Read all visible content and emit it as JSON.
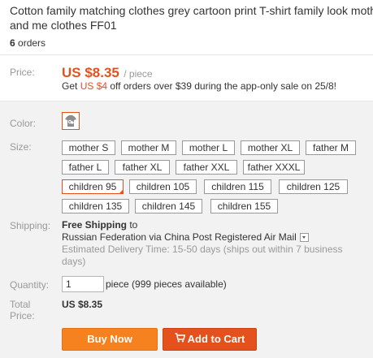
{
  "product": {
    "title_line1": "Cotton family matching clothes grey cartoon print T-shirt family look moth",
    "title_line2": "and me clothes FF01",
    "orders_count": "6",
    "orders_label": "orders"
  },
  "price": {
    "label": "Price:",
    "value": "US $8.35",
    "unit": "/ piece",
    "promo_prefix": "Get ",
    "promo_amount": "US $4",
    "promo_suffix": " off orders over $39 during the app-only sale on 25/8!"
  },
  "color": {
    "label": "Color:",
    "icon": "cartoon-shirt-thumbnail"
  },
  "size": {
    "label": "Size:",
    "options": [
      "mother S",
      "mother M",
      "mother L",
      "mother XL",
      "father M",
      "father L",
      "father XL",
      "father XXL",
      "father XXXL",
      "children 95",
      "children 105",
      "children 115",
      "children 125",
      "children 135",
      "children 145",
      "children 155"
    ],
    "selected": "children 95"
  },
  "shipping": {
    "label": "Shipping:",
    "free": "Free Shipping",
    "to": " to",
    "destination": "Russian Federation via China Post Registered Air Mail",
    "delivery": "Estimated Delivery Time: 15-50 days (ships out within 7 business days)"
  },
  "quantity": {
    "label": "Quantity:",
    "value": "1",
    "note": "piece (999 pieces available)"
  },
  "total": {
    "label_line1": "Total",
    "label_line2": "Price:",
    "value": "US $8.35"
  },
  "actions": {
    "buy_now": "Buy Now",
    "add_to_cart": "Add to Cart"
  },
  "colors": {
    "accent": "#e5511d",
    "buy": "#f5821f",
    "muted": "#999999",
    "panel": "#f2f2f2"
  }
}
